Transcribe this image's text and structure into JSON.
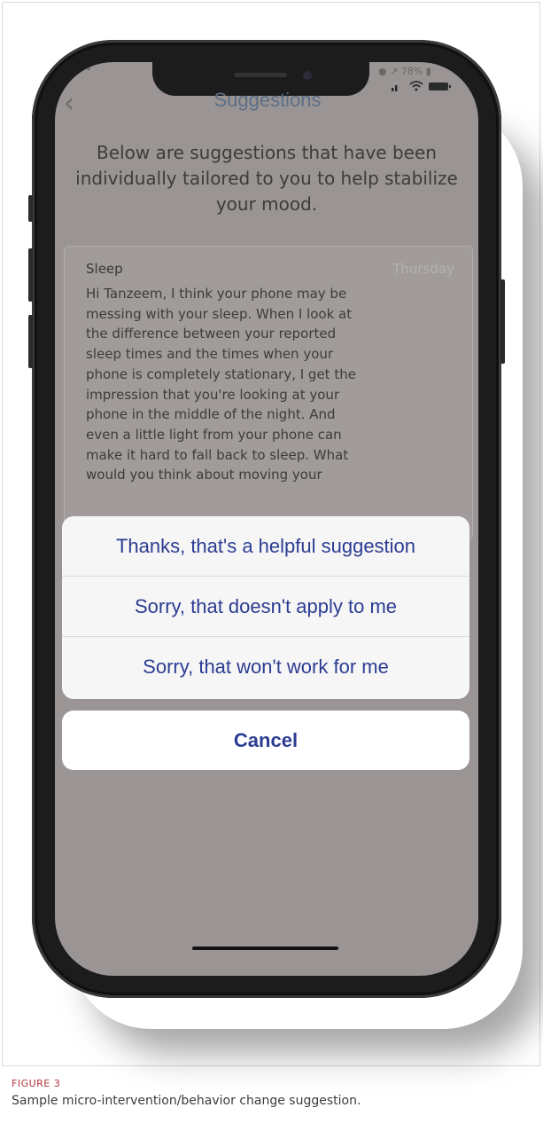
{
  "status_bar": {
    "left": "• •",
    "right": "● ↗ 78% ▮"
  },
  "nav": {
    "back_icon": "chevron-left-icon",
    "title": "Suggestions"
  },
  "intro_text": "Below are suggestions that have been individually tailored to you to help stabilize your mood.",
  "card": {
    "title": "Sleep",
    "day": "Thursday",
    "lines": [
      "Hi Tanzeem, I think your phone may be",
      "messing with your sleep. When I look at",
      "the difference between your reported",
      "sleep times and the times when your",
      "phone is completely stationary, I get the",
      "impression that you're looking at your",
      "phone in the middle of the night. And",
      "even a little light from your phone can",
      "make it hard to fall back to sleep. What",
      "would you think about moving your"
    ]
  },
  "action_sheet": {
    "options": [
      "Thanks, that's a helpful suggestion",
      "Sorry, that doesn't apply to me",
      "Sorry, that won't work for me"
    ],
    "cancel": "Cancel"
  },
  "colors": {
    "action_text": "#2c3c92",
    "screen_dim": "#9a9594",
    "caption_label": "#b0323a"
  },
  "caption": {
    "label": "FIGURE 3",
    "text": "Sample micro-intervention/behavior change suggestion."
  }
}
